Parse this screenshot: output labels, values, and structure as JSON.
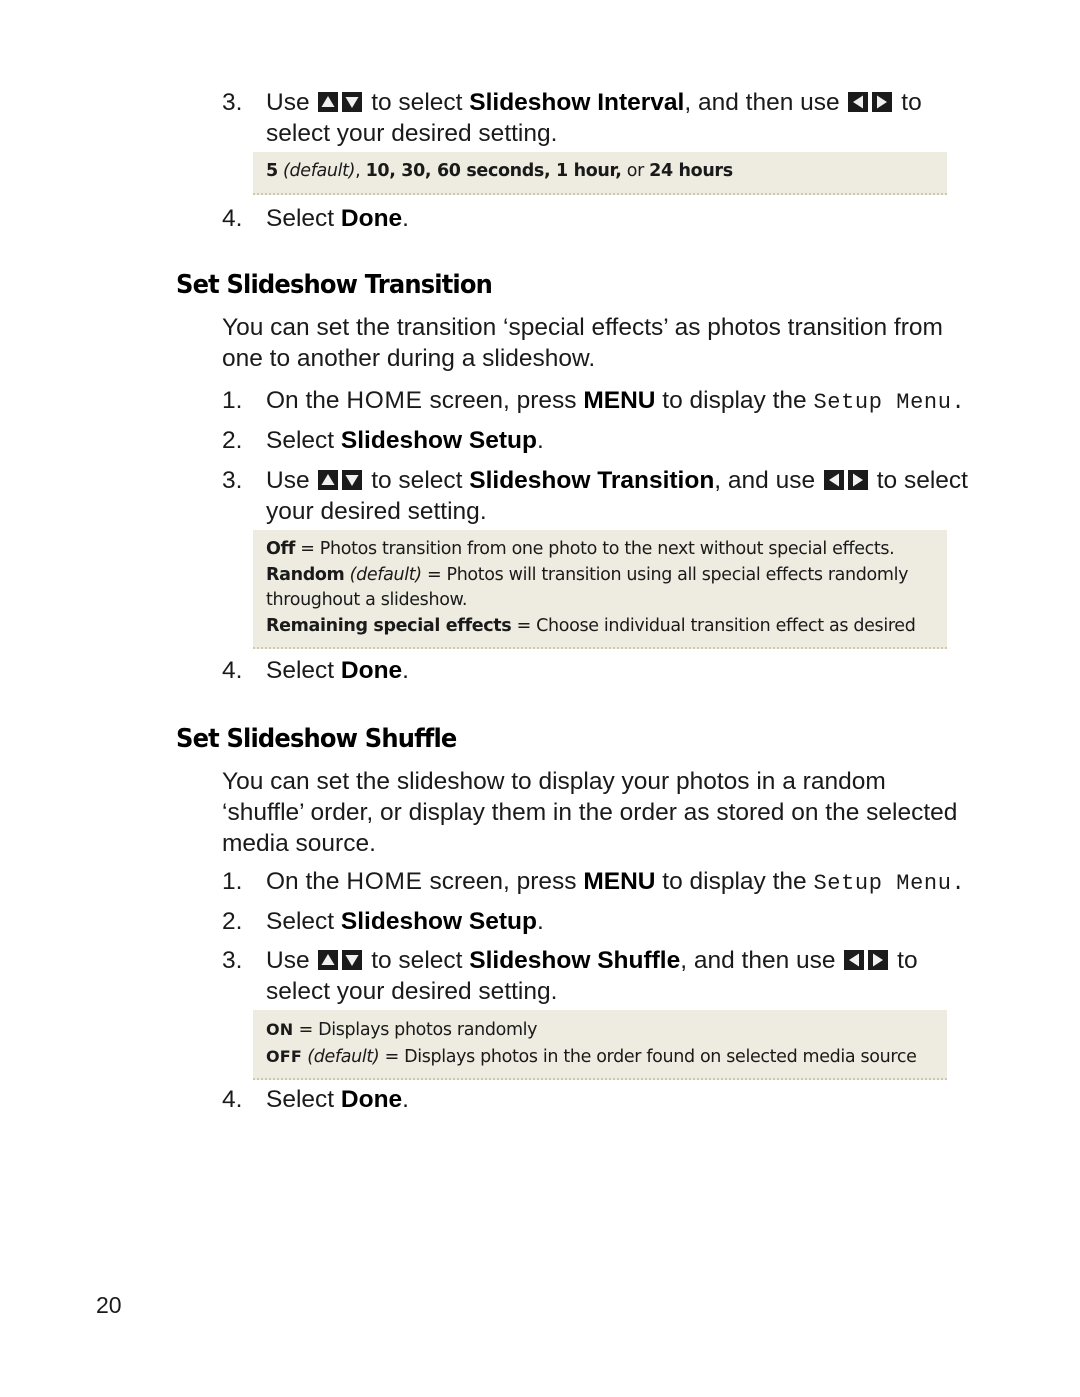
{
  "document": {
    "page_number": "20",
    "sections": [
      {
        "id": "slideshow-interval-tail",
        "steps": [
          {
            "number": "3.",
            "parts": [
              {
                "t": "Use ",
                "s": "plain"
              },
              {
                "t": "up-arrow-key",
                "s": "icon"
              },
              {
                "t": "down-arrow-key",
                "s": "icon"
              },
              {
                "t": " to select ",
                "s": "plain"
              },
              {
                "t": "Slideshow Interval",
                "s": "bold"
              },
              {
                "t": ", and then use ",
                "s": "plain"
              },
              {
                "t": "left-arrow-key",
                "s": "icon"
              },
              {
                "t": "right-arrow-key",
                "s": "icon"
              },
              {
                "t": " to select your desired setting.",
                "s": "plain"
              }
            ],
            "line1": "Use \u0001\u0002 to select Slideshow Interval, and then use \u0003\u0004 to",
            "line2": "select your desired setting."
          },
          {
            "number": "4.",
            "text_plain": "Select ",
            "text_bold": "Done",
            "text_after": "."
          }
        ],
        "note": {
          "lines": [
            [
              {
                "t": "5",
                "s": "bold"
              },
              {
                "t": " ",
                "s": "plain"
              },
              {
                "t": "(default)",
                "s": "italic"
              },
              {
                "t": ", ",
                "s": "plain"
              },
              {
                "t": "10, 30, 60 seconds, 1 hour,",
                "s": "bold"
              },
              {
                "t": " or ",
                "s": "plain"
              },
              {
                "t": "24 hours",
                "s": "bold"
              }
            ]
          ]
        }
      },
      {
        "id": "set-slideshow-transition",
        "heading": "Set Slideshow Transition",
        "intro_line1": "You can set the transition ‘special effects’ as photos transition from",
        "intro_line2": "one to another during a slideshow.",
        "steps": [
          {
            "number": "1.",
            "pre": "On the ",
            "home": "HOME",
            "mid": " screen, press ",
            "menu": "MENU",
            "mid2": " to display the ",
            "setupmenu": "Setup Menu",
            "post": "."
          },
          {
            "number": "2.",
            "text_plain": "Select ",
            "text_bold": "Slideshow Setup",
            "text_after": "."
          },
          {
            "number": "3.",
            "line1_pre": "Use ",
            "line1_mid": " to select ",
            "line1_bold": "Slideshow Transition",
            "line1_mid2": ", and use ",
            "line1_post": " to select",
            "line2": "your desired setting."
          },
          {
            "number": "4.",
            "text_plain": "Select ",
            "text_bold": "Done",
            "text_after": "."
          }
        ],
        "note": {
          "lines": [
            [
              {
                "t": "Off",
                "s": "bold"
              },
              {
                "t": " = Photos transition from one photo to the next without special effects.",
                "s": "plain"
              }
            ],
            [
              {
                "t": "Random",
                "s": "bold"
              },
              {
                "t": " ",
                "s": "plain"
              },
              {
                "t": "(default)",
                "s": "italic"
              },
              {
                "t": " = Photos will transition using all special effects randomly",
                "s": "plain"
              }
            ],
            [
              {
                "t": "throughout a slideshow.",
                "s": "plain"
              }
            ],
            [
              {
                "t": "Remaining special effects",
                "s": "bold"
              },
              {
                "t": " = Choose individual transition effect as desired",
                "s": "plain"
              }
            ]
          ]
        }
      },
      {
        "id": "set-slideshow-shuffle",
        "heading": "Set Slideshow Shuffle",
        "intro_line1": "You can set the slideshow to display your photos in a random",
        "intro_line2": "‘shuffle’ order, or display them in the order as stored on the selected",
        "intro_line3": "media source.",
        "steps": [
          {
            "number": "1.",
            "pre": "On the ",
            "home": "HOME",
            "mid": " screen, press ",
            "menu": "MENU",
            "mid2": " to display the ",
            "setupmenu": "Setup Menu",
            "post": "."
          },
          {
            "number": "2.",
            "text_plain": "Select ",
            "text_bold": "Slideshow Setup",
            "text_after": "."
          },
          {
            "number": "3.",
            "line1_pre": "Use ",
            "line1_mid": " to select ",
            "line1_bold": "Slideshow Shuffle",
            "line1_mid2": ", and then use ",
            "line1_post": " to",
            "line2": "select your desired setting."
          },
          {
            "number": "4.",
            "text_plain": "Select ",
            "text_bold": "Done",
            "text_after": "."
          }
        ],
        "note": {
          "lines": [
            [
              {
                "t": "ON",
                "s": "boldcaps"
              },
              {
                "t": " = Displays photos randomly",
                "s": "plain"
              }
            ],
            [
              {
                "t": "OFF",
                "s": "boldcaps"
              },
              {
                "t": " ",
                "s": "plain"
              },
              {
                "t": "(default)",
                "s": "italic"
              },
              {
                "t": " = Displays photos in the order found on selected media source",
                "s": "plain"
              }
            ]
          ]
        }
      }
    ],
    "icons": {
      "up": "up-arrow-key-icon",
      "down": "down-arrow-key-icon",
      "left": "left-arrow-key-icon",
      "right": "right-arrow-key-icon"
    },
    "colors": {
      "note_background": "#eeebe0",
      "note_border": "#cfc8ae",
      "key_background": "#1b1b1b",
      "key_glyph": "#f2f2f2",
      "text": "#1a1a1a"
    }
  }
}
